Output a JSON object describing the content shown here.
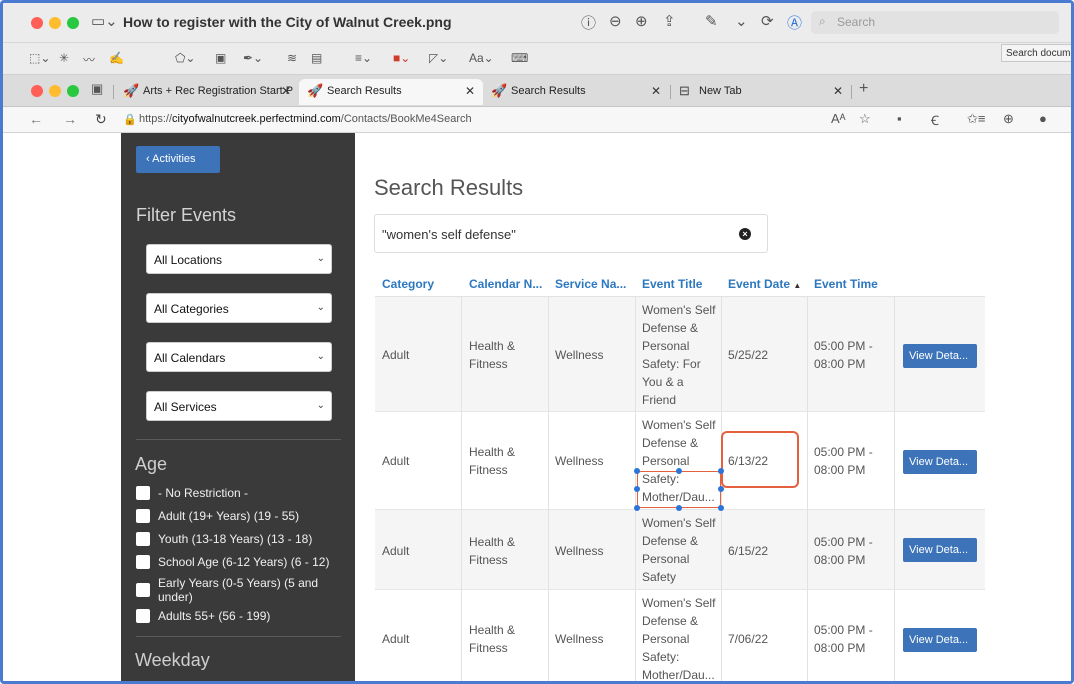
{
  "preview": {
    "title": "How to register with the City of Walnut Creek.png",
    "search_placeholder": "Search",
    "tooltip": "Search document"
  },
  "browser": {
    "tabs": [
      {
        "label": "Arts + Rec Registration Start P"
      },
      {
        "label": "Search Results"
      },
      {
        "label": "Search Results"
      },
      {
        "label": "New Tab"
      }
    ],
    "url_prefix": "https://",
    "url_host": "cityofwalnutcreek.perfectmind.com",
    "url_path": "/Contacts/BookMe4Search"
  },
  "sidebar": {
    "activities_button": "Activities",
    "filter_title": "Filter Events",
    "selects": [
      "All Locations",
      "All Categories",
      "All Calendars",
      "All Services"
    ],
    "age_title": "Age",
    "age_options": [
      "- No Restriction -",
      "Adult (19+ Years) (19 - 55)",
      "Youth (13-18 Years) (13 - 18)",
      "School Age (6-12 Years) (6 - 12)",
      "Early Years (0-5 Years) (5 and under)",
      "Adults 55+ (56 - 199)"
    ],
    "weekday_title": "Weekday"
  },
  "main": {
    "title": "Search Results",
    "search_value": "\"women's self defense\"",
    "columns": [
      "Category",
      "Calendar N...",
      "Service Na...",
      "Event Title",
      "Event Date",
      "Event Time"
    ],
    "sort_indicator": "▲",
    "rows": [
      {
        "category": "Adult",
        "calendar": "Health & Fitness",
        "service": "Wellness",
        "title_lines": [
          "Women's Self",
          "Defense &",
          "Personal",
          "Safety: For",
          "You & a",
          "Friend"
        ],
        "date": "5/25/22",
        "time": "05:00 PM - 08:00 PM",
        "button": "View Deta..."
      },
      {
        "category": "Adult",
        "calendar": "Health & Fitness",
        "service": "Wellness",
        "title_lines": [
          "Women's Self",
          "Defense &",
          "Personal",
          "Safety:",
          "Mother/Dau..."
        ],
        "date": "6/13/22",
        "time": "05:00 PM - 08:00 PM",
        "button": "View Deta..."
      },
      {
        "category": "Adult",
        "calendar": "Health & Fitness",
        "service": "Wellness",
        "title_lines": [
          "Women's Self",
          "Defense &",
          "Personal",
          "Safety"
        ],
        "date": "6/15/22",
        "time": "05:00 PM - 08:00 PM",
        "button": "View Deta..."
      },
      {
        "category": "Adult",
        "calendar": "Health & Fitness",
        "service": "Wellness",
        "title_lines": [
          "Women's Self",
          "Defense &",
          "Personal",
          "Safety:",
          "Mother/Dau..."
        ],
        "date": "7/06/22",
        "time": "05:00 PM - 08:00 PM",
        "button": "View Deta..."
      }
    ]
  },
  "colors": {
    "accent": "#3c73b9",
    "link": "#2c78c0",
    "sidebar": "#3a3a3a",
    "annotation": "#e5603f"
  }
}
